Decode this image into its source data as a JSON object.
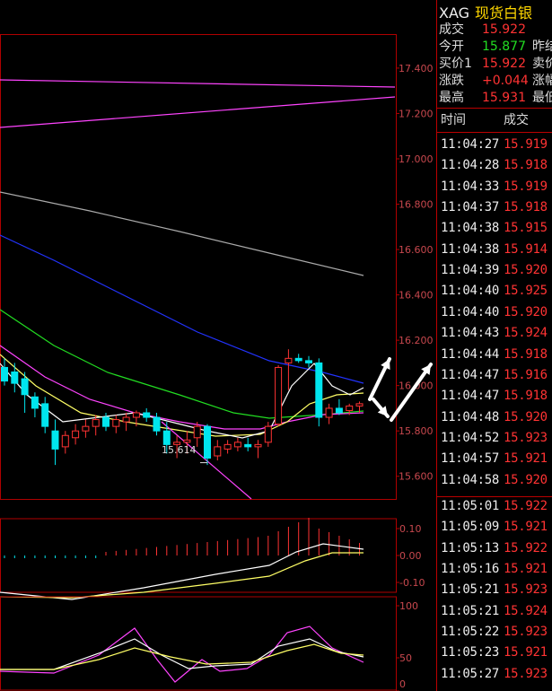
{
  "sidebar": {
    "code": "XAG",
    "name": "现货白银",
    "quote_rows": [
      {
        "label": "成交",
        "value": "15.922",
        "color": "#ff3333",
        "label2": ""
      },
      {
        "label": "今开",
        "value": "15.877",
        "color": "#22dd22",
        "label2": "昨结"
      },
      {
        "label": "买价1",
        "value": "15.922",
        "color": "#ff3333",
        "label2": "卖价"
      },
      {
        "label": "涨跌",
        "value": "+0.044",
        "color": "#ff3333",
        "label2": "涨幅"
      },
      {
        "label": "最高",
        "value": "15.931",
        "color": "#ff3333",
        "label2": "最低"
      }
    ],
    "header": {
      "time": "时间",
      "price": "成交"
    },
    "ticks": [
      {
        "time": "11:04:27",
        "price": "15.919"
      },
      {
        "time": "11:04:28",
        "price": "15.918"
      },
      {
        "time": "11:04:33",
        "price": "15.919"
      },
      {
        "time": "11:04:37",
        "price": "15.918"
      },
      {
        "time": "11:04:38",
        "price": "15.915"
      },
      {
        "time": "11:04:38",
        "price": "15.914"
      },
      {
        "time": "11:04:39",
        "price": "15.920"
      },
      {
        "time": "11:04:40",
        "price": "15.925"
      },
      {
        "time": "11:04:40",
        "price": "15.920"
      },
      {
        "time": "11:04:43",
        "price": "15.924"
      },
      {
        "time": "11:04:44",
        "price": "15.918"
      },
      {
        "time": "11:04:47",
        "price": "15.916"
      },
      {
        "time": "11:04:47",
        "price": "15.918"
      },
      {
        "time": "11:04:48",
        "price": "15.920"
      },
      {
        "time": "11:04:52",
        "price": "15.923"
      },
      {
        "time": "11:04:57",
        "price": "15.921"
      },
      {
        "time": "11:04:58",
        "price": "15.920"
      },
      {
        "time": "11:05:01",
        "price": "15.922"
      },
      {
        "time": "11:05:09",
        "price": "15.921"
      },
      {
        "time": "11:05:13",
        "price": "15.922"
      },
      {
        "time": "11:05:16",
        "price": "15.921"
      },
      {
        "time": "11:05:21",
        "price": "15.923"
      },
      {
        "time": "11:05:21",
        "price": "15.924"
      },
      {
        "time": "11:05:22",
        "price": "15.923"
      },
      {
        "time": "11:05:23",
        "price": "15.921"
      },
      {
        "time": "11:05:27",
        "price": "15.923"
      }
    ]
  },
  "chart": {
    "price_axis": [
      "17.400",
      "17.200",
      "17.000",
      "16.800",
      "16.600",
      "16.400",
      "16.200",
      "16.000",
      "15.800",
      "15.600"
    ],
    "macd_axis": [
      "0.10",
      "0.00",
      "-0.10"
    ],
    "kdj_axis": [
      "100",
      "50",
      "0"
    ],
    "low_label": "15.614",
    "colors": {
      "up": "#ff3333",
      "down": "#00e5ee",
      "grid": "#b00000",
      "ma_blue": "#2233ff",
      "ma_green": "#22dd22",
      "ma_magenta": "#ff44ff",
      "ma_yellow": "#ffff66",
      "ma_white": "#ffffff",
      "ma_gray": "#aaaaaa"
    }
  },
  "chart_data": {
    "type": "candlestick",
    "price_ylim": [
      15.5,
      17.55
    ],
    "candles": [
      {
        "o": 16.08,
        "h": 16.12,
        "l": 16.0,
        "c": 16.02
      },
      {
        "o": 16.06,
        "h": 16.1,
        "l": 15.97,
        "c": 16.01
      },
      {
        "o": 16.03,
        "h": 16.06,
        "l": 15.88,
        "c": 15.96
      },
      {
        "o": 15.95,
        "h": 15.97,
        "l": 15.86,
        "c": 15.9
      },
      {
        "o": 15.92,
        "h": 15.95,
        "l": 15.79,
        "c": 15.82
      },
      {
        "o": 15.8,
        "h": 15.85,
        "l": 15.65,
        "c": 15.72
      },
      {
        "o": 15.73,
        "h": 15.8,
        "l": 15.7,
        "c": 15.78
      },
      {
        "o": 15.77,
        "h": 15.83,
        "l": 15.74,
        "c": 15.8
      },
      {
        "o": 15.8,
        "h": 15.85,
        "l": 15.77,
        "c": 15.82
      },
      {
        "o": 15.82,
        "h": 15.87,
        "l": 15.78,
        "c": 15.85
      },
      {
        "o": 15.86,
        "h": 15.88,
        "l": 15.8,
        "c": 15.82
      },
      {
        "o": 15.82,
        "h": 15.87,
        "l": 15.79,
        "c": 15.85
      },
      {
        "o": 15.84,
        "h": 15.88,
        "l": 15.8,
        "c": 15.86
      },
      {
        "o": 15.86,
        "h": 15.89,
        "l": 15.82,
        "c": 15.88
      },
      {
        "o": 15.88,
        "h": 15.9,
        "l": 15.84,
        "c": 15.86
      },
      {
        "o": 15.86,
        "h": 15.88,
        "l": 15.78,
        "c": 15.8
      },
      {
        "o": 15.8,
        "h": 15.84,
        "l": 15.7,
        "c": 15.74
      },
      {
        "o": 15.74,
        "h": 15.78,
        "l": 15.68,
        "c": 15.75
      },
      {
        "o": 15.75,
        "h": 15.8,
        "l": 15.7,
        "c": 15.76
      },
      {
        "o": 15.77,
        "h": 15.84,
        "l": 15.73,
        "c": 15.82
      },
      {
        "o": 15.82,
        "h": 15.83,
        "l": 15.65,
        "c": 15.68
      },
      {
        "o": 15.69,
        "h": 15.76,
        "l": 15.67,
        "c": 15.73
      },
      {
        "o": 15.72,
        "h": 15.76,
        "l": 15.7,
        "c": 15.74
      },
      {
        "o": 15.73,
        "h": 15.77,
        "l": 15.71,
        "c": 15.75
      },
      {
        "o": 15.74,
        "h": 15.77,
        "l": 15.71,
        "c": 15.73
      },
      {
        "o": 15.73,
        "h": 15.76,
        "l": 15.68,
        "c": 15.74
      },
      {
        "o": 15.75,
        "h": 15.84,
        "l": 15.73,
        "c": 15.82
      },
      {
        "o": 15.83,
        "h": 16.09,
        "l": 15.82,
        "c": 16.08
      },
      {
        "o": 16.1,
        "h": 16.16,
        "l": 15.98,
        "c": 16.12
      },
      {
        "o": 16.12,
        "h": 16.14,
        "l": 16.1,
        "c": 16.11
      },
      {
        "o": 16.11,
        "h": 16.13,
        "l": 16.08,
        "c": 16.1
      },
      {
        "o": 16.1,
        "h": 16.12,
        "l": 15.82,
        "c": 15.86
      },
      {
        "o": 15.86,
        "h": 15.92,
        "l": 15.83,
        "c": 15.9
      },
      {
        "o": 15.9,
        "h": 15.94,
        "l": 15.87,
        "c": 15.88
      },
      {
        "o": 15.89,
        "h": 15.92,
        "l": 15.87,
        "c": 15.91
      },
      {
        "o": 15.91,
        "h": 15.93,
        "l": 15.88,
        "c": 15.92
      }
    ]
  }
}
